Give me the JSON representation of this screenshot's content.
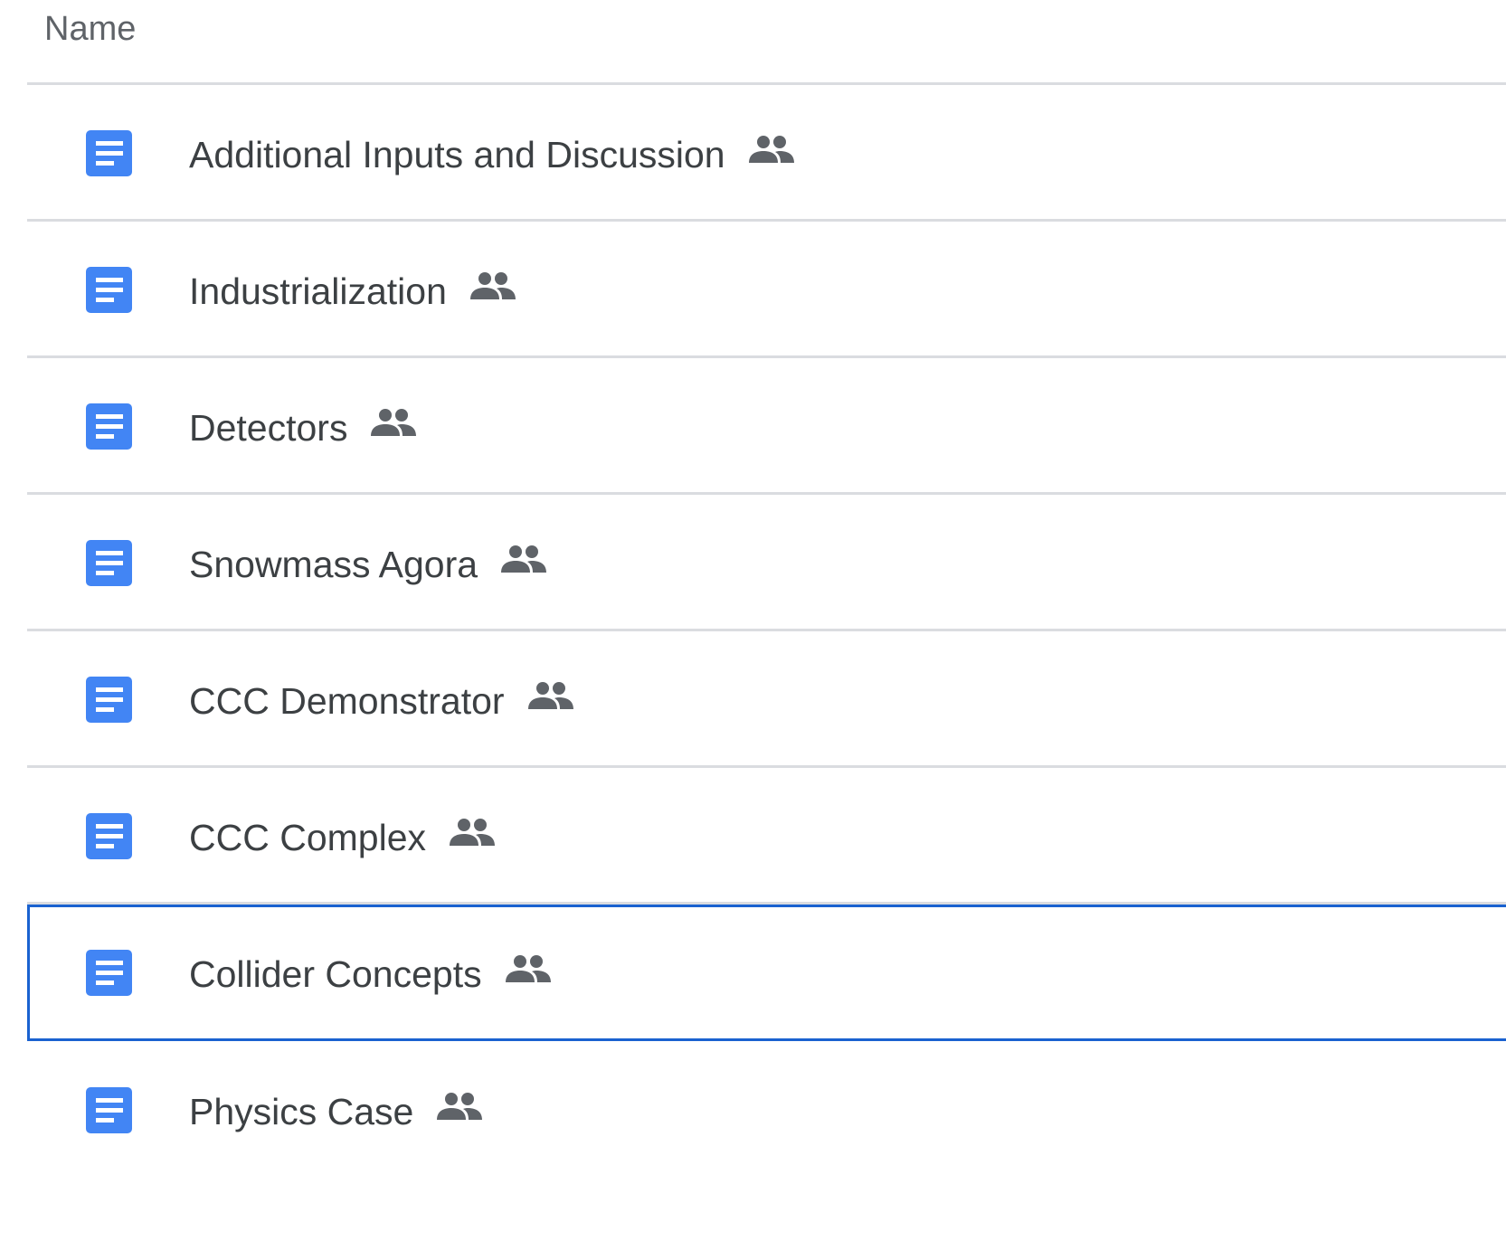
{
  "header": {
    "name_label": "Name"
  },
  "files": [
    {
      "name": "Additional Inputs and Discussion",
      "icon": "google-docs-icon",
      "shared_icon": "shared-people-icon",
      "selected": false
    },
    {
      "name": "Industrialization",
      "icon": "google-docs-icon",
      "shared_icon": "shared-people-icon",
      "selected": false
    },
    {
      "name": "Detectors",
      "icon": "google-docs-icon",
      "shared_icon": "shared-people-icon",
      "selected": false
    },
    {
      "name": "Snowmass Agora",
      "icon": "google-docs-icon",
      "shared_icon": "shared-people-icon",
      "selected": false
    },
    {
      "name": "CCC Demonstrator",
      "icon": "google-docs-icon",
      "shared_icon": "shared-people-icon",
      "selected": false
    },
    {
      "name": "CCC Complex",
      "icon": "google-docs-icon",
      "shared_icon": "shared-people-icon",
      "selected": false
    },
    {
      "name": "Collider Concepts",
      "icon": "google-docs-icon",
      "shared_icon": "shared-people-icon",
      "selected": true
    },
    {
      "name": "Physics Case",
      "icon": "google-docs-icon",
      "shared_icon": "shared-people-icon",
      "selected": false
    }
  ],
  "colors": {
    "doc_icon_blue": "#4285f4",
    "selection_border": "#1a62d0",
    "divider": "#dadce0",
    "text": "#3c4043",
    "header_text": "#5f6368",
    "shared_icon": "#5f6368"
  }
}
